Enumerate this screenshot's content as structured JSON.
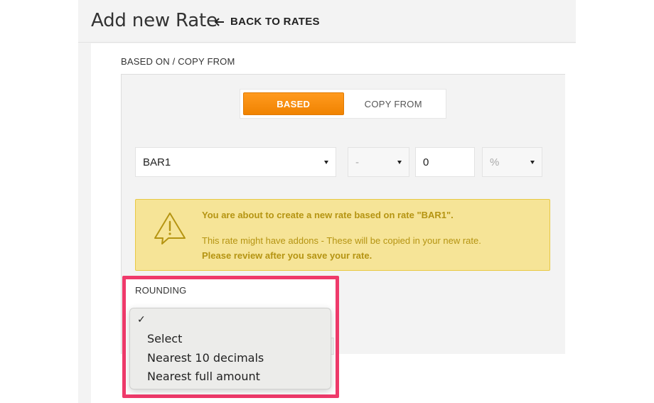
{
  "header": {
    "title": "Add new Rate",
    "back_label": "BACK TO RATES"
  },
  "based_section": {
    "label": "BASED ON / COPY FROM",
    "toggle": {
      "active": "BASED",
      "inactive": "COPY FROM"
    }
  },
  "fields": {
    "base_rate": "BAR1",
    "sign": "-",
    "amount": "0",
    "unit": "%"
  },
  "alert": {
    "line1": "You are about to create a new rate based on rate \"BAR1\".",
    "line2": "This rate might have addons - These will be copied in your new rate.",
    "line3": "Please review after you save your rate."
  },
  "rounding": {
    "label": "ROUNDING",
    "check": "✓",
    "options": [
      "Select",
      "Nearest 10 decimals",
      "Nearest full amount"
    ]
  },
  "colors": {
    "accent": "#f08300",
    "highlight": "#ef3a6b",
    "warning_bg": "#f6e497",
    "warning_text": "#b59412"
  }
}
